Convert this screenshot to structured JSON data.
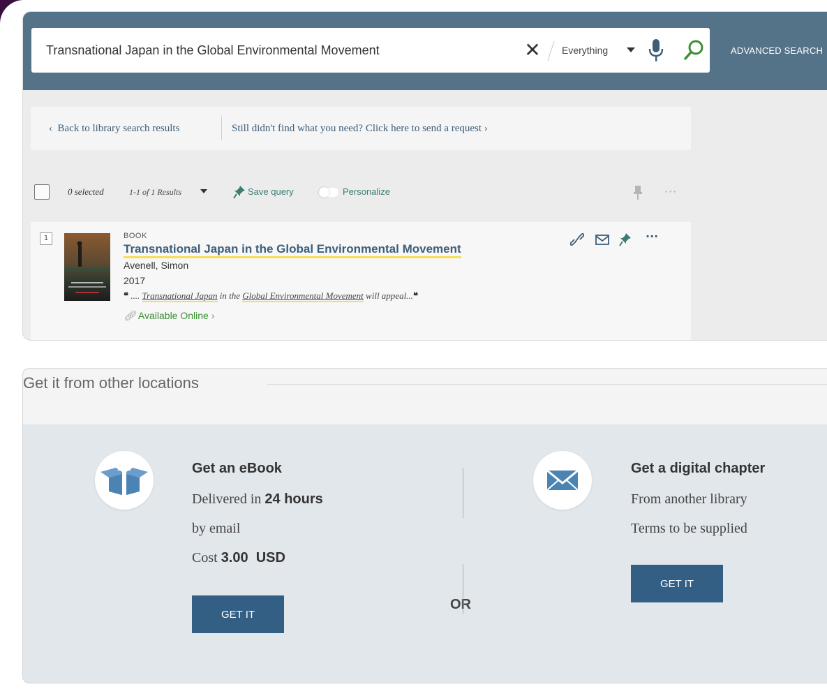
{
  "search": {
    "query": "Transnational Japan in the Global Environmental Movement",
    "scope": "Everything",
    "advanced_label": "ADVANCED SEARCH"
  },
  "nav": {
    "back_label": "Back to library search results",
    "request_label": "Still didn't find what you need? Click here to send a request"
  },
  "toolbar": {
    "selected": "0 selected",
    "results": "1-1 of 1 Results",
    "save_query": "Save query",
    "personalize": "Personalize",
    "more": "···"
  },
  "result": {
    "number": "1",
    "type": "BOOK",
    "title": "Transnational Japan in the Global Environmental Movement",
    "author": "Avenell, Simon",
    "year": "2017",
    "snippet_pre": " .... ",
    "snippet_hl1": "Transnational Japan",
    "snippet_mid": " in the ",
    "snippet_hl2": "Global Environmental Movement",
    "snippet_post": " will appeal...",
    "availability": "Available Online",
    "more": "···"
  },
  "other_locations": {
    "heading": "Get it from other locations",
    "option1": {
      "title": "Get an eBook",
      "line1_pre": "Delivered in ",
      "line1_bold": "24 hours",
      "line2": "by email",
      "line3_pre": "Cost ",
      "line3_bold": "3.00  USD",
      "button": "GET IT"
    },
    "or_label": "OR",
    "option2": {
      "title": "Get a digital chapter",
      "line1": "From another library",
      "line2": "Terms to be supplied",
      "button": "GET IT"
    }
  },
  "colors": {
    "header_bar": "#547389",
    "link": "#3d5e79",
    "accent_teal": "#3a7d72",
    "available_green": "#3d8f35",
    "highlight": "#f6de58",
    "button": "#335f85"
  }
}
